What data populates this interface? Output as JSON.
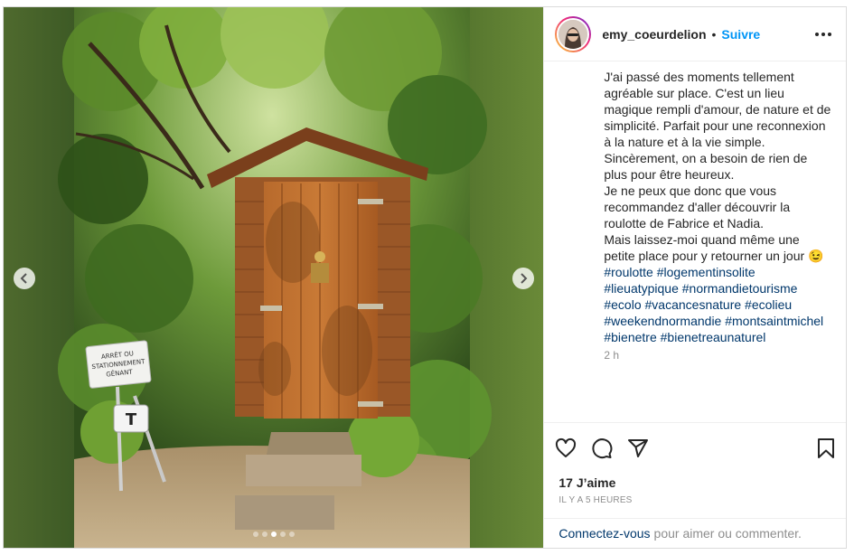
{
  "post": {
    "username": "emy_coeurdelion",
    "separator": "•",
    "follow_label": "Suivre",
    "caption_p1": "J'ai passé des moments tellement agréable sur place. C'est un lieu magique rempli d'amour, de nature et de simplicité. Parfait pour une reconnexion à la nature et à la vie simple. Sincèrement, on a besoin de rien de plus pour être heureux.",
    "caption_p2": "Je ne peux que donc que vous recommandez d'aller découvrir la roulotte de Fabrice et Nadia.\nMais laissez-moi quand même une petite place pour y retourner un jour 😉",
    "hashtags": [
      "#roulotte",
      "#logementinsolite",
      "#lieuatypique",
      "#normandietourisme",
      "#ecolo",
      "#vacancesnature",
      "#ecolieu",
      "#weekendnormandie",
      "#montsaintmichel",
      "#bienetre",
      "#bienetreaunaturel"
    ],
    "caption_age": "2 h",
    "likes": "17 J’aime",
    "posted": "IL Y A 5 HEURES",
    "login_link": "Connectez-vous",
    "login_rest": "pour aimer ou commenter."
  },
  "media": {
    "sign_line1": "ARRÊT OU",
    "sign_line2": "STATIONNEMENT",
    "sign_line3": "GÊNANT",
    "stool_letter": "T",
    "carousel_count": 5,
    "carousel_active": 3
  },
  "icons": {
    "prev": "chevron-left-icon",
    "next": "chevron-right-icon",
    "like": "heart-icon",
    "comment": "comment-icon",
    "share": "paper-plane-icon",
    "save": "bookmark-icon",
    "more": "more-horizontal-icon"
  },
  "colors": {
    "follow": "#0095f6",
    "hashtag": "#00376b",
    "muted": "#8e8e8e",
    "text": "#262626"
  }
}
